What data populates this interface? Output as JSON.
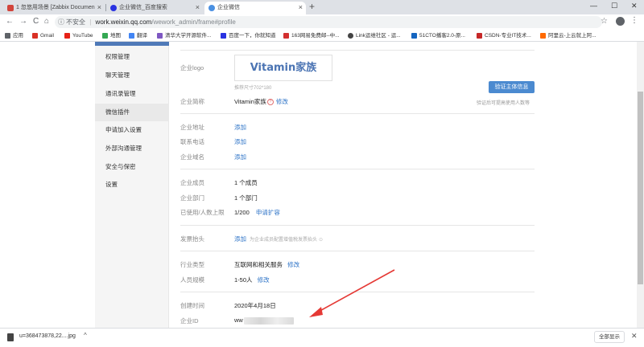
{
  "browser": {
    "tabs": [
      {
        "title": "1 忽悠用场景 [Zabbix Documen",
        "active": false
      },
      {
        "title": "企业微信_百度搜索",
        "active": false
      },
      {
        "title": "企业微信",
        "active": true
      }
    ],
    "new_tab": "+",
    "window_controls": [
      "—",
      "☐",
      "✕"
    ],
    "nav": {
      "back": "←",
      "forward": "→",
      "reload": "C",
      "home": "⌂"
    },
    "url": {
      "security": "不安全",
      "separator": "|",
      "host": "work.weixin.qq.com",
      "path": "/wework_admin/frame#profile"
    },
    "bookmarks": [
      {
        "label": "应用",
        "color": "#5f6368"
      },
      {
        "label": "Gmail",
        "color": "#d93025"
      },
      {
        "label": "YouTube",
        "color": "#e62117"
      },
      {
        "label": "地图",
        "color": "#34a853"
      },
      {
        "label": "翻译",
        "color": "#4285f4"
      },
      {
        "label": "清华大学开源软件...",
        "color": "#7e57c2"
      },
      {
        "label": "百度一下，你就知道",
        "color": "#2932e1"
      },
      {
        "label": "163网易免费邮--中...",
        "color": "#d32f2f"
      },
      {
        "label": "Link运维社区 - 运...",
        "color": "#444444"
      },
      {
        "label": "51CTO播客2.0-原...",
        "color": "#1565c0"
      },
      {
        "label": "CSDN-专业IT技术...",
        "color": "#c62828"
      },
      {
        "label": "阿里云-上云就上阿...",
        "color": "#ff6a00"
      }
    ]
  },
  "sidebar": {
    "items": [
      {
        "label": "权限管理",
        "active": false
      },
      {
        "label": "聊天管理",
        "active": false
      },
      {
        "label": "通讯录管理",
        "active": false
      },
      {
        "label": "微信插件",
        "active": true
      },
      {
        "label": "申请加入设置",
        "active": false
      },
      {
        "label": "外部沟通管理",
        "active": false
      },
      {
        "label": "安全与保密",
        "active": false
      },
      {
        "label": "设置",
        "active": false
      }
    ]
  },
  "profile": {
    "logo": {
      "label": "企业logo",
      "logo_text": "Vitamin家族",
      "hint": "推荐尺寸702*180"
    },
    "verify": {
      "button": "验证主体信息",
      "hint": "验证后可提高使用人数等"
    },
    "short_name": {
      "label": "企业简称",
      "value": "Vitamin家族",
      "help_icon": "?",
      "action": "修改"
    },
    "address": {
      "label": "企业地址",
      "action": "添加"
    },
    "phone": {
      "label": "联系电话",
      "action": "添加"
    },
    "domain": {
      "label": "企业域名",
      "action": "添加"
    },
    "members": {
      "label": "企业成员",
      "value": "1 个成员"
    },
    "departments": {
      "label": "企业部门",
      "value": "1 个部门"
    },
    "capacity": {
      "label": "已使用/人数上限",
      "value": "1/200",
      "action": "申请扩容"
    },
    "invoice": {
      "label": "发票抬头",
      "action": "添加",
      "hint": "为企业成员配置增值税发票抬头"
    },
    "industry": {
      "label": "行业类型",
      "value": "互联网和相关服务",
      "action": "修改"
    },
    "scale": {
      "label": "人员规模",
      "value": "1-50人",
      "action": "修改"
    },
    "created": {
      "label": "创建时间",
      "value": "2020年4月18日"
    },
    "corp_id": {
      "label": "企业ID",
      "value_prefix": "ww"
    }
  },
  "download": {
    "filename": "u=368473878,22....jpg",
    "chevron": "^",
    "show_all": "全部显示",
    "close": "✕"
  },
  "colors": {
    "accent": "#2d73c7",
    "button": "#4b8ad0",
    "arrow": "#e53935",
    "sidebar_bar": "#4f79b8"
  }
}
